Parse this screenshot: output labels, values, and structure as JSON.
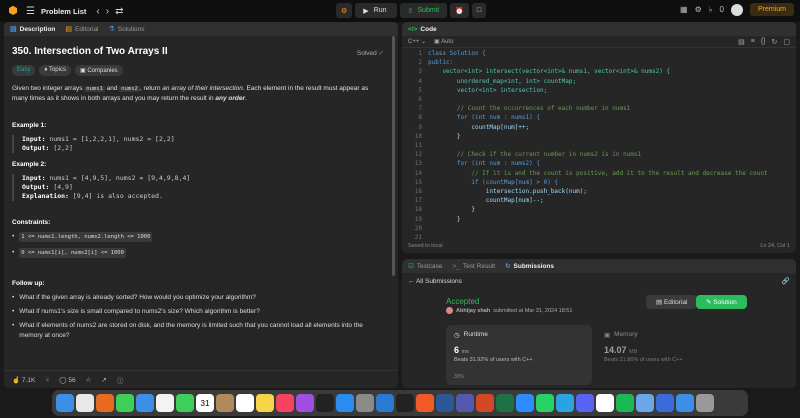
{
  "topbar": {
    "problem_list": "Problem List",
    "run": "Run",
    "submit": "Submit",
    "notifications": "0",
    "premium": "Premium"
  },
  "left": {
    "tabs": [
      "Description",
      "Editorial",
      "Solutions"
    ],
    "title": "350. Intersection of Two Arrays II",
    "status": "Solved",
    "badges": [
      "Easy",
      "Topics",
      "Companies"
    ],
    "intro": {
      "p1": "Given two integer arrays ",
      "c1": "nums1",
      "p2": " and ",
      "c2": "nums2",
      "p3": ", return ",
      "em1": "an array of their intersection",
      "p4": ". Each element in the result must appear as many times as it shows in both arrays and you may return the result in ",
      "em2": "any order",
      "p5": "."
    },
    "example1": {
      "label": "Example 1:",
      "input_k": "Input:",
      "input_v": " nums1 = [1,2,2,1], nums2 = [2,2]",
      "output_k": "Output:",
      "output_v": " [2,2]"
    },
    "example2": {
      "label": "Example 2:",
      "input_k": "Input:",
      "input_v": " nums1 = [4,9,5], nums2 = [9,4,9,8,4]",
      "output_k": "Output:",
      "output_v": " [4,9]",
      "expl_k": "Explanation:",
      "expl_v": " [9,4] is also accepted."
    },
    "constraints_label": "Constraints:",
    "constraints": [
      "1 <= nums1.length, nums2.length <= 1000",
      "0 <= nums1[i], nums2[i] <= 1000"
    ],
    "followup_label": "Follow up:",
    "followup": [
      "What if the given array is already sorted? How would you optimize your algorithm?",
      "What if nums1's size is small compared to nums2's size? Which algorithm is better?",
      "What if elements of nums2 are stored on disk, and the memory is limited such that you cannot load all elements into the memory at once?"
    ],
    "likes": "7.1K",
    "comments": "56"
  },
  "code": {
    "tab": "Code",
    "language": "C++",
    "mode": "Auto",
    "saved": "Saved to local",
    "cursor": "Ln 24, Col 1",
    "lines": [
      {
        "n": "1",
        "t": "class Solution {"
      },
      {
        "n": "2",
        "t": "public:"
      },
      {
        "n": "3",
        "t": "    vector<int> intersect(vector<int>& nums1, vector<int>& nums2) {"
      },
      {
        "n": "4",
        "t": "        unordered_map<int, int> countMap;"
      },
      {
        "n": "5",
        "t": "        vector<int> intersection;"
      },
      {
        "n": "6",
        "t": ""
      },
      {
        "n": "7",
        "t": "        // Count the occurrences of each number in nums1"
      },
      {
        "n": "8",
        "t": "        for (int num : nums1) {"
      },
      {
        "n": "9",
        "t": "            countMap[num]++;"
      },
      {
        "n": "10",
        "t": "        }"
      },
      {
        "n": "11",
        "t": ""
      },
      {
        "n": "12",
        "t": "        // Check if the current number in nums2 is in nums1"
      },
      {
        "n": "13",
        "t": "        for (int num : nums2) {"
      },
      {
        "n": "14",
        "t": "            // If it is and the count is positive, add it to the result and decrease the count"
      },
      {
        "n": "15",
        "t": "            if (countMap[num] > 0) {"
      },
      {
        "n": "16",
        "t": "                intersection.push_back(num);"
      },
      {
        "n": "17",
        "t": "                countMap[num]--;"
      },
      {
        "n": "18",
        "t": "            }"
      },
      {
        "n": "19",
        "t": "        }"
      },
      {
        "n": "20",
        "t": ""
      },
      {
        "n": "21",
        "t": ""
      }
    ]
  },
  "subs": {
    "tabs": [
      "Testcase",
      "Test Result",
      "Submissions"
    ],
    "back": "All Submissions",
    "accepted": "Accepted",
    "user": "Abhijay shah",
    "submitted": "submitted at Mar 31, 2024 18:51",
    "editorial": "Editorial",
    "solution": "Solution",
    "runtime_label": "Runtime",
    "runtime_val": "6",
    "runtime_unit": "ms",
    "runtime_beats": "Beats 31.92% of users with C++",
    "memory_label": "Memory",
    "memory_val": "14.07",
    "memory_unit": "MB",
    "memory_beats": "Beats 21.86% of users with C++",
    "pct": "30%"
  },
  "dock": {
    "calendar_day": "31",
    "icons": [
      "finder-icon",
      "chrome-icon",
      "firefox-icon",
      "messages-icon",
      "mail-icon",
      "photos-icon",
      "facetime-icon",
      "calendar-icon",
      "contacts-icon",
      "reminders-icon",
      "notes-icon",
      "music-icon",
      "podcasts-icon",
      "tv-icon",
      "appstore-icon",
      "settings-icon",
      "vscode-icon",
      "terminal-icon",
      "brave-icon",
      "word-icon",
      "teams-icon",
      "powerpoint-icon",
      "excel-icon",
      "zoom-icon",
      "whatsapp-icon",
      "telegram-icon",
      "discord-icon",
      "notion-icon",
      "spotify-icon",
      "preview-icon",
      "downloads-icon",
      "folder-icon",
      "trash-icon"
    ]
  }
}
